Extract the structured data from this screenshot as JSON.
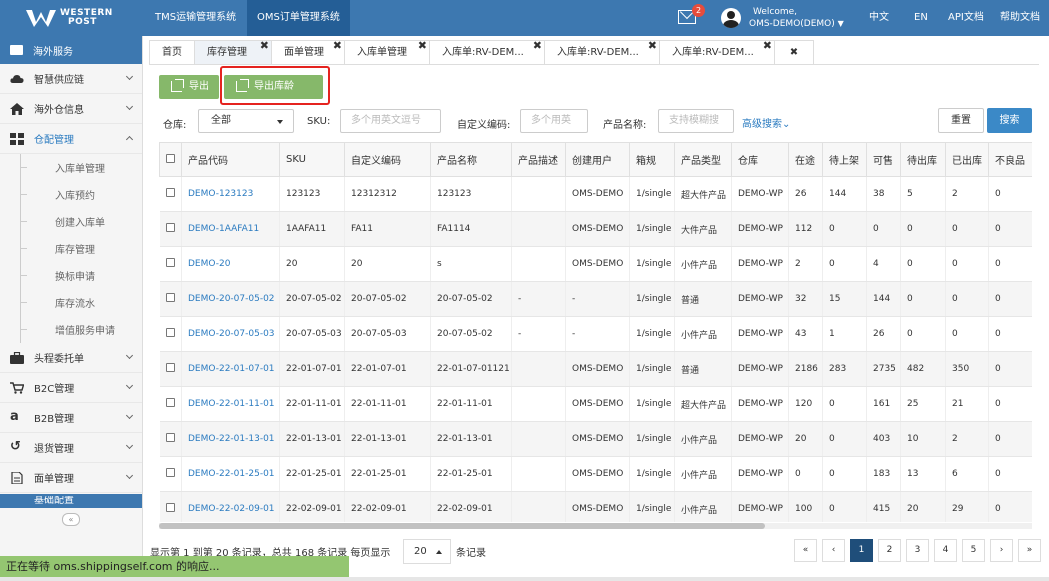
{
  "header": {
    "logo_text_line1": "WESTERN",
    "logo_text_line2": "POST",
    "systems": [
      "TMS运输管理系统",
      "OMS订单管理系统"
    ],
    "notification_count": "2",
    "welcome_line1": "Welcome,",
    "welcome_line2": "OMS-DEMO(DEMO)",
    "lang_zh": "中文",
    "lang_en": "EN",
    "api_doc": "API文档",
    "help_doc": "帮助文档"
  },
  "sidebar": {
    "head": "海外服务",
    "items": [
      {
        "label": "智慧供应链",
        "icon": "cloud-icon"
      },
      {
        "label": "海外仓信息",
        "icon": "home-icon"
      },
      {
        "label": "仓配管理",
        "icon": "grid-icon",
        "expanded": true
      }
    ],
    "subitems": [
      "入库单管理",
      "入库预约",
      "创建入库单",
      "库存管理",
      "换标申请",
      "库存流水",
      "增值服务申请"
    ],
    "items2": [
      {
        "label": "头程委托单",
        "icon": "briefcase-icon"
      },
      {
        "label": "B2C管理",
        "icon": "cart-icon"
      },
      {
        "label": "B2B管理",
        "icon": "amazon-icon"
      },
      {
        "label": "退货管理",
        "icon": "return-icon"
      },
      {
        "label": "面单管理",
        "icon": "document-icon"
      },
      {
        "label": "基础配置",
        "icon": "settings-icon"
      }
    ],
    "collapse_symbol": "«"
  },
  "tabs": [
    {
      "label": "首页",
      "closable": false
    },
    {
      "label": "库存管理",
      "closable": true,
      "active": true
    },
    {
      "label": "面单管理",
      "closable": true
    },
    {
      "label": "入库单管理",
      "closable": true
    },
    {
      "label": "入库单:RV-DEM...",
      "closable": true
    },
    {
      "label": "入库单:RV-DEM...",
      "closable": true
    },
    {
      "label": "入库单:RV-DEM...",
      "closable": true
    },
    {
      "label": "",
      "closable": true
    }
  ],
  "toolbar": {
    "export_label": "导出",
    "export_age_label": "导出库龄"
  },
  "filters": {
    "warehouse_label": "仓库:",
    "warehouse_value": "全部",
    "sku_label": "SKU:",
    "sku_placeholder": "多个用英文逗号",
    "custom_code_label": "自定义编码:",
    "custom_code_placeholder": "多个用英",
    "product_name_label": "产品名称:",
    "product_name_placeholder": "支持模糊搜",
    "advanced_search": "高级搜索",
    "reset": "重置",
    "search": "搜索"
  },
  "table": {
    "columns": [
      "",
      "产品代码",
      "SKU",
      "自定义编码",
      "产品名称",
      "产品描述",
      "创建用户",
      "箱规",
      "产品类型",
      "仓库",
      "在途",
      "待上架",
      "可售",
      "待出库",
      "已出库",
      "不良品"
    ],
    "rows": [
      [
        "DEMO-123123",
        "123123",
        "12312312",
        "123123",
        "",
        "OMS-DEMO",
        "1/single",
        "超大件产品",
        "DEMO-WP",
        "26",
        "144",
        "38",
        "5",
        "2",
        "0"
      ],
      [
        "DEMO-1AAFA11",
        "1AAFA11",
        "FA11",
        "FA1114",
        "",
        "OMS-DEMO",
        "1/single",
        "大件产品",
        "DEMO-WP",
        "112",
        "0",
        "0",
        "0",
        "0",
        "0"
      ],
      [
        "DEMO-20",
        "20",
        "20",
        "s",
        "",
        "OMS-DEMO",
        "1/single",
        "小件产品",
        "DEMO-WP",
        "2",
        "0",
        "4",
        "0",
        "0",
        "0"
      ],
      [
        "DEMO-20-07-05-02",
        "20-07-05-02",
        "20-07-05-02",
        "20-07-05-02",
        "-",
        "-",
        "1/single",
        "普通",
        "DEMO-WP",
        "32",
        "15",
        "144",
        "0",
        "0",
        "0"
      ],
      [
        "DEMO-20-07-05-03",
        "20-07-05-03",
        "20-07-05-03",
        "20-07-05-02",
        "-",
        "-",
        "1/single",
        "小件产品",
        "DEMO-WP",
        "43",
        "1",
        "26",
        "0",
        "0",
        "0"
      ],
      [
        "DEMO-22-01-07-01",
        "22-01-07-01",
        "22-01-07-01",
        "22-01-07-01121",
        "",
        "OMS-DEMO",
        "1/single",
        "普通",
        "DEMO-WP",
        "2186",
        "283",
        "2735",
        "482",
        "350",
        "0"
      ],
      [
        "DEMO-22-01-11-01",
        "22-01-11-01",
        "22-01-11-01",
        "22-01-11-01",
        "",
        "OMS-DEMO",
        "1/single",
        "超大件产品",
        "DEMO-WP",
        "120",
        "0",
        "161",
        "25",
        "21",
        "0"
      ],
      [
        "DEMO-22-01-13-01",
        "22-01-13-01",
        "22-01-13-01",
        "22-01-13-01",
        "",
        "OMS-DEMO",
        "1/single",
        "小件产品",
        "DEMO-WP",
        "20",
        "0",
        "403",
        "10",
        "2",
        "0"
      ],
      [
        "DEMO-22-01-25-01",
        "22-01-25-01",
        "22-01-25-01",
        "22-01-25-01",
        "",
        "OMS-DEMO",
        "1/single",
        "小件产品",
        "DEMO-WP",
        "0",
        "0",
        "183",
        "13",
        "6",
        "0"
      ],
      [
        "DEMO-22-02-09-01",
        "22-02-09-01",
        "22-02-09-01",
        "22-02-09-01",
        "",
        "OMS-DEMO",
        "1/single",
        "小件产品",
        "DEMO-WP",
        "100",
        "0",
        "415",
        "20",
        "29",
        "0"
      ]
    ]
  },
  "footer": {
    "summary": "显示第 1 到第 20 条记录，总共 168 条记录 每页显示",
    "page_size": "20",
    "suffix": "条记录",
    "pages": [
      "«",
      "‹",
      "1",
      "2",
      "3",
      "4",
      "5",
      "›",
      "»"
    ],
    "current_page": "1"
  },
  "status_bar": "正在等待 oms.shippingself.com 的响应...",
  "colors": {
    "header": "#3d78b0",
    "green_button": "#86b86a",
    "link": "#2b7bc0",
    "highlight": "#e5231f",
    "search_button": "#3b89c7"
  }
}
